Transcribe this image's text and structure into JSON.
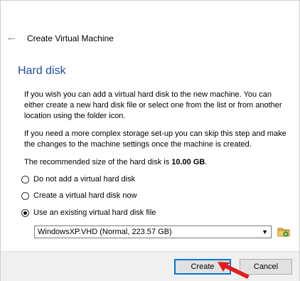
{
  "header": {
    "back_icon": "back-arrow-icon",
    "title": "Create Virtual Machine"
  },
  "page": {
    "title": "Hard disk",
    "para1": "If you wish you can add a virtual hard disk to the new machine. You can either create a new hard disk file or select one from the list or from another location using the folder icon.",
    "para2": "If you need a more complex storage set-up you can skip this step and make the changes to the machine settings once the machine is created.",
    "para3_prefix": "The recommended size of the hard disk is ",
    "para3_value": "10.00 GB",
    "para3_suffix": "."
  },
  "options": [
    {
      "label": "Do not add a virtual hard disk",
      "checked": false
    },
    {
      "label": "Create a virtual hard disk now",
      "checked": false
    },
    {
      "label": "Use an existing virtual hard disk file",
      "checked": true
    }
  ],
  "disk_select": {
    "value": "WindowsXP.VHD (Normal, 223.57 GB)",
    "arrow_icon": "dropdown-arrow-icon",
    "folder_icon": "folder-icon"
  },
  "buttons": {
    "create": "Create",
    "cancel": "Cancel"
  },
  "colors": {
    "title_blue": "#1f4e9c",
    "focus_blue": "#0078d7",
    "annotation_red": "#e01e1e"
  }
}
